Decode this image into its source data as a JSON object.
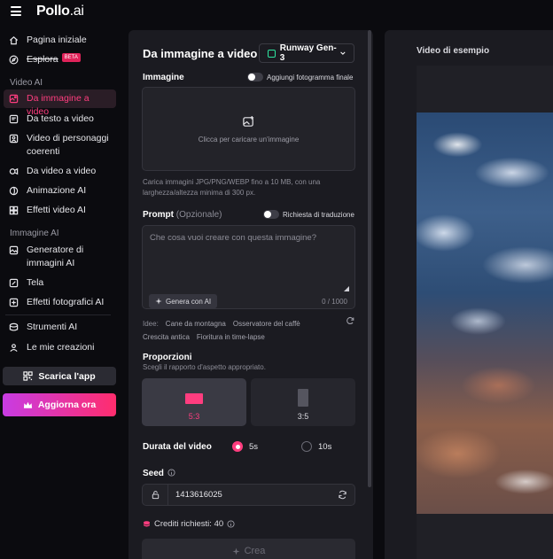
{
  "app": {
    "logo_main": "Pollo",
    "logo_suffix": ".ai"
  },
  "sidebar": {
    "items_top": [
      {
        "label": "Pagina iniziale",
        "icon": "home-icon"
      },
      {
        "label": "Esplora",
        "icon": "compass-icon",
        "badge": "BETA"
      }
    ],
    "section_video": "Video AI",
    "items_video": [
      {
        "label": "Da immagine a video",
        "icon": "image-video-icon",
        "active": true
      },
      {
        "label": "Da testo a video",
        "icon": "text-video-icon"
      },
      {
        "label": "Video di personaggi coerenti",
        "icon": "character-icon"
      },
      {
        "label": "Da video a video",
        "icon": "video-video-icon"
      },
      {
        "label": "Animazione AI",
        "icon": "animation-icon"
      },
      {
        "label": "Effetti video AI",
        "icon": "effects-icon"
      }
    ],
    "section_image": "Immagine AI",
    "items_image": [
      {
        "label": "Generatore di immagini AI",
        "icon": "image-gen-icon"
      },
      {
        "label": "Tela",
        "icon": "canvas-icon"
      },
      {
        "label": "Effetti fotografici AI",
        "icon": "photo-effects-icon"
      }
    ],
    "items_bottom": [
      {
        "label": "Strumenti AI",
        "icon": "tools-icon"
      },
      {
        "label": "Le mie creazioni",
        "icon": "creations-icon"
      }
    ],
    "download_app": "Scarica l'app",
    "upgrade": "Aggiorna ora"
  },
  "panel": {
    "title": "Da immagine a video",
    "model": "Runway Gen-3",
    "image_label": "Immagine",
    "add_final_frame": "Aggiungi fotogramma finale",
    "upload_text": "Clicca per caricare un'immagine",
    "upload_hint": "Carica immagini JPG/PNG/WEBP fino a 10 MB, con una larghezza/altezza minima di 300 px.",
    "prompt_label": "Prompt",
    "prompt_optional": "(Opzionale)",
    "translation_request": "Richiesta di traduzione",
    "prompt_placeholder": "Che cosa vuoi creare con questa immagine?",
    "generate_ai": "Genera con AI",
    "char_counter": "0 / 1000",
    "ideas_label": "Idee:",
    "ideas": [
      "Cane da montagna",
      "Osservatore del caffè",
      "Crescita antica",
      "Fioritura in time-lapse"
    ],
    "proportions_label": "Proporzioni",
    "proportions_sub": "Scegli il rapporto d'aspetto appropriato.",
    "ratios": [
      "5:3",
      "3:5"
    ],
    "selected_ratio": "5:3",
    "duration_label": "Durata del video",
    "durations": [
      "5s",
      "10s"
    ],
    "selected_duration": "5s",
    "seed_label": "Seed",
    "seed_value": "1413616025",
    "credits": "Crediti richiesti: 40",
    "create": "Crea"
  },
  "preview": {
    "title": "Video di esempio"
  },
  "colors": {
    "accent": "#ff3d7f",
    "model_logo": "#2ee6a0",
    "upgrade_from": "#c83ce3",
    "upgrade_to": "#ff2d6d"
  }
}
